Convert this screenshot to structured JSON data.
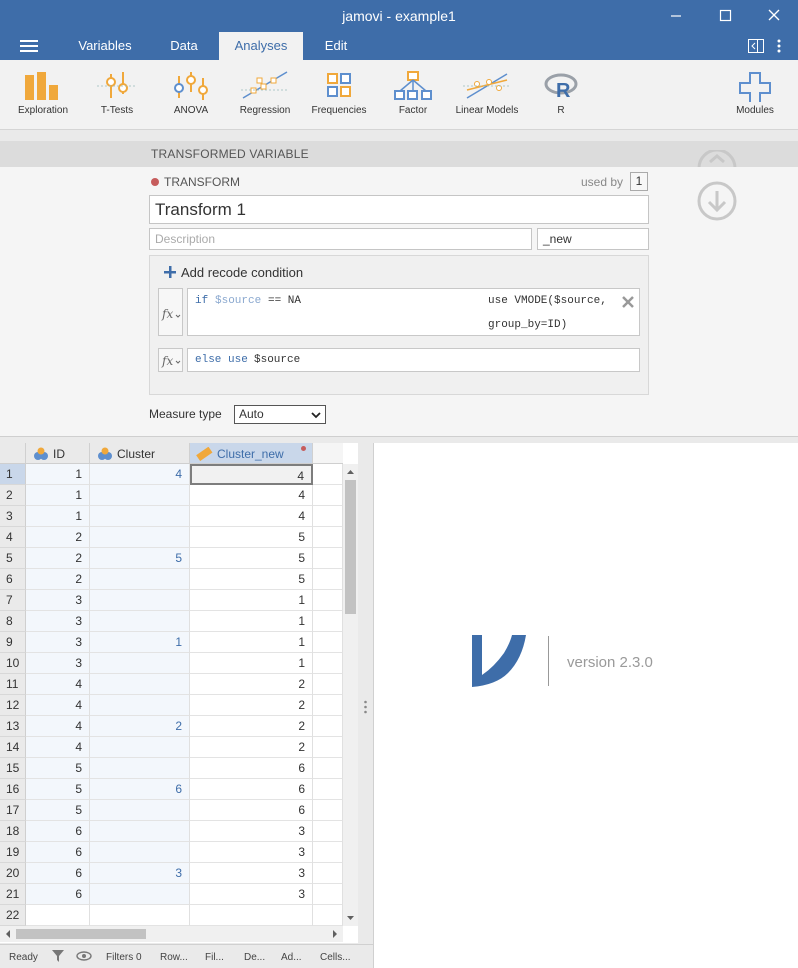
{
  "window": {
    "title": "jamovi - example1"
  },
  "tabs": [
    {
      "label": "Variables"
    },
    {
      "label": "Data"
    },
    {
      "label": "Analyses"
    },
    {
      "label": "Edit"
    }
  ],
  "ribbon": [
    {
      "label": "Exploration"
    },
    {
      "label": "T-Tests"
    },
    {
      "label": "ANOVA"
    },
    {
      "label": "Regression"
    },
    {
      "label": "Frequencies"
    },
    {
      "label": "Factor"
    },
    {
      "label": "Linear Models"
    },
    {
      "label": "R"
    },
    {
      "label": "Modules"
    }
  ],
  "transform": {
    "section_title": "TRANSFORMED VARIABLE",
    "heading": "TRANSFORM",
    "used_by_label": "used by",
    "used_by_count": "1",
    "name": "Transform 1",
    "description_placeholder": "Description",
    "suffix": "_new",
    "add_condition": "Add recode condition",
    "cond1_if": "if",
    "cond1_var": "$source",
    "cond1_op": "== NA",
    "cond1_use_line1": "use VMODE($source,",
    "cond1_use_line2": "group_by=ID)",
    "cond2_else": "else use",
    "cond2_var": "$source",
    "measure_label": "Measure type",
    "measure_value": "Auto"
  },
  "sheet": {
    "headers": [
      "ID",
      "Cluster",
      "Cluster_new"
    ],
    "rows": [
      {
        "n": "1",
        "id": "1",
        "cluster": "4",
        "new": "4"
      },
      {
        "n": "2",
        "id": "1",
        "cluster": "",
        "new": "4"
      },
      {
        "n": "3",
        "id": "1",
        "cluster": "",
        "new": "4"
      },
      {
        "n": "4",
        "id": "2",
        "cluster": "",
        "new": "5"
      },
      {
        "n": "5",
        "id": "2",
        "cluster": "5",
        "new": "5"
      },
      {
        "n": "6",
        "id": "2",
        "cluster": "",
        "new": "5"
      },
      {
        "n": "7",
        "id": "3",
        "cluster": "",
        "new": "1"
      },
      {
        "n": "8",
        "id": "3",
        "cluster": "",
        "new": "1"
      },
      {
        "n": "9",
        "id": "3",
        "cluster": "1",
        "new": "1"
      },
      {
        "n": "10",
        "id": "3",
        "cluster": "",
        "new": "1"
      },
      {
        "n": "11",
        "id": "4",
        "cluster": "",
        "new": "2"
      },
      {
        "n": "12",
        "id": "4",
        "cluster": "",
        "new": "2"
      },
      {
        "n": "13",
        "id": "4",
        "cluster": "2",
        "new": "2"
      },
      {
        "n": "14",
        "id": "4",
        "cluster": "",
        "new": "2"
      },
      {
        "n": "15",
        "id": "5",
        "cluster": "",
        "new": "6"
      },
      {
        "n": "16",
        "id": "5",
        "cluster": "6",
        "new": "6"
      },
      {
        "n": "17",
        "id": "5",
        "cluster": "",
        "new": "6"
      },
      {
        "n": "18",
        "id": "6",
        "cluster": "",
        "new": "3"
      },
      {
        "n": "19",
        "id": "6",
        "cluster": "",
        "new": "3"
      },
      {
        "n": "20",
        "id": "6",
        "cluster": "3",
        "new": "3"
      },
      {
        "n": "21",
        "id": "6",
        "cluster": "",
        "new": "3"
      },
      {
        "n": "22",
        "id": "",
        "cluster": "",
        "new": ""
      }
    ]
  },
  "results": {
    "version": "version 2.3.0"
  },
  "status": {
    "ready": "Ready",
    "filters": "Filters 0",
    "rows": "Row...",
    "filtered": "Fil...",
    "deleted": "De...",
    "added": "Ad...",
    "cells": "Cells..."
  },
  "colors": {
    "brand": "#3e6da9",
    "accent": "#f0a83b",
    "computed": "#c65c5c"
  }
}
